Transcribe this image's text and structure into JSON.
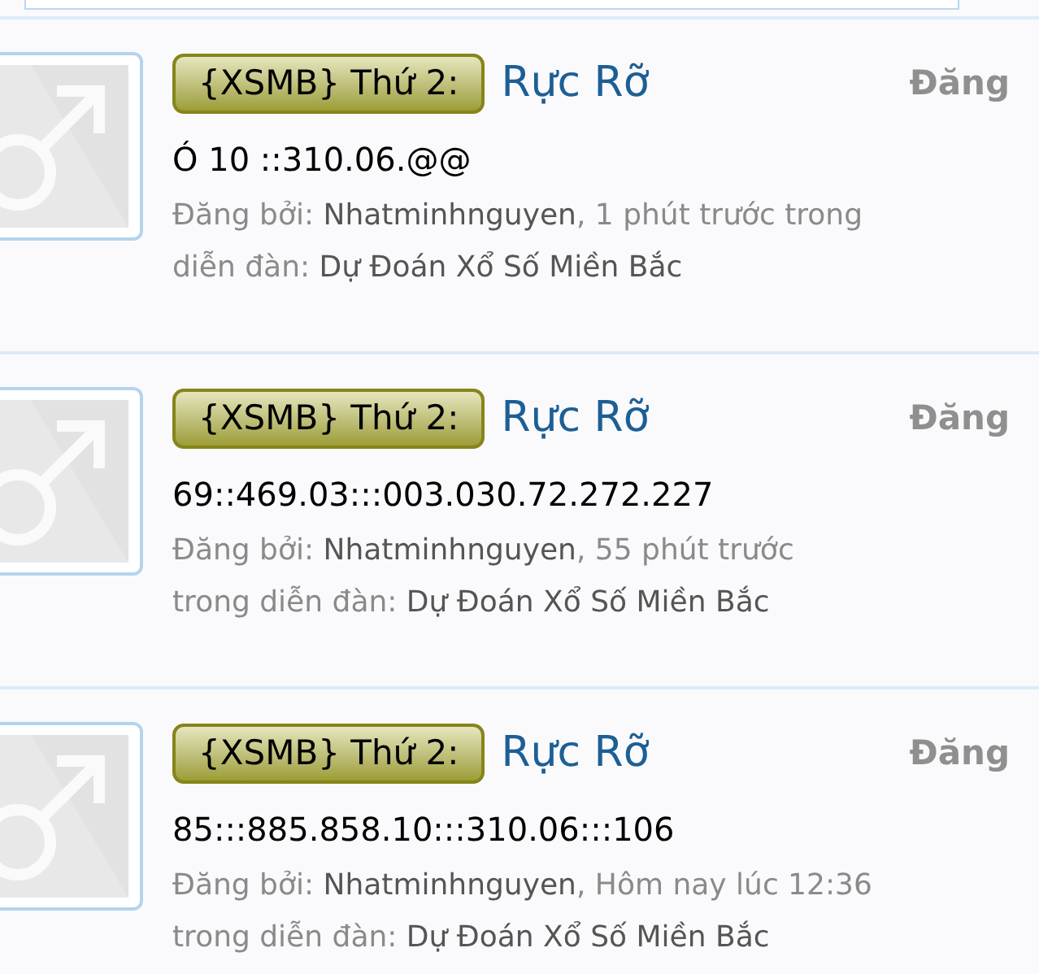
{
  "results": [
    {
      "prefix": "{XSMB} Thứ 2:",
      "title": "Rực Rỡ",
      "snippet": "Ó 10 ::310.06.@@",
      "by_label": "Đăng bởi:",
      "author": "Nhatminhnguyen",
      "time": ", 1 phút trước trong diễn đàn:",
      "forum": "Dự Đoán Xổ Số Miền Bắc",
      "side_label": "Đăng"
    },
    {
      "prefix": "{XSMB} Thứ 2:",
      "title": "Rực Rỡ",
      "snippet": "69::469.03:::003.030.72.272.227",
      "by_label": "Đăng bởi:",
      "author": "Nhatminhnguyen",
      "time": ", 55 phút trước trong diễn đàn:",
      "forum": "Dự Đoán Xổ Số Miền Bắc",
      "side_label": "Đăng"
    },
    {
      "prefix": "{XSMB} Thứ 2:",
      "title": "Rực Rỡ",
      "snippet": "85:::885.858.10:::310.06:::106",
      "by_label": "Đăng bởi:",
      "author": "Nhatminhnguyen",
      "time": ", Hôm nay lúc 12:36 trong diễn đàn:",
      "forum": "Dự Đoán Xổ Số Miền Bắc",
      "side_label": "Đăng"
    }
  ]
}
